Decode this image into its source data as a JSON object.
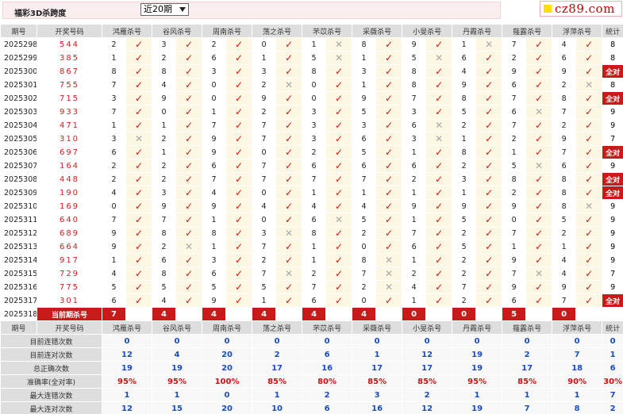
{
  "header": {
    "title": "福彩3D杀跨度",
    "select_value": "近20期",
    "logo_text": "cz89.com"
  },
  "columns": {
    "period": "期号",
    "draw": "开奖号码",
    "experts": [
      "鸿雁杀号",
      "谷风杀号",
      "周南杀号",
      "荡之杀号",
      "芣苡杀号",
      "采薇杀号",
      "小旻杀号",
      "丹霞杀号",
      "薤露杀号",
      "浮萍杀号"
    ],
    "total": "统计"
  },
  "rows": [
    {
      "p": "2025298",
      "d": "544",
      "v": [
        [
          2,
          1
        ],
        [
          3,
          1
        ],
        [
          2,
          1
        ],
        [
          0,
          1
        ],
        [
          1,
          0
        ],
        [
          8,
          1
        ],
        [
          9,
          1
        ],
        [
          1,
          0
        ],
        [
          7,
          1
        ],
        [
          4,
          1
        ]
      ],
      "c": "8"
    },
    {
      "p": "2025299",
      "d": "385",
      "v": [
        [
          1,
          1
        ],
        [
          2,
          1
        ],
        [
          6,
          1
        ],
        [
          1,
          1
        ],
        [
          5,
          0
        ],
        [
          1,
          1
        ],
        [
          5,
          0
        ],
        [
          6,
          1
        ],
        [
          2,
          1
        ],
        [
          6,
          1
        ]
      ],
      "c": "8"
    },
    {
      "p": "2025300",
      "d": "867",
      "v": [
        [
          8,
          1
        ],
        [
          8,
          1
        ],
        [
          3,
          1
        ],
        [
          3,
          1
        ],
        [
          8,
          1
        ],
        [
          3,
          1
        ],
        [
          8,
          1
        ],
        [
          4,
          1
        ],
        [
          9,
          1
        ],
        [
          9,
          1
        ]
      ],
      "c": "全对"
    },
    {
      "p": "2025301",
      "d": "755",
      "v": [
        [
          7,
          1
        ],
        [
          4,
          1
        ],
        [
          0,
          1
        ],
        [
          2,
          0
        ],
        [
          0,
          1
        ],
        [
          1,
          1
        ],
        [
          8,
          1
        ],
        [
          9,
          1
        ],
        [
          6,
          1
        ],
        [
          2,
          0
        ]
      ],
      "c": "8"
    },
    {
      "p": "2025302",
      "d": "715",
      "v": [
        [
          3,
          1
        ],
        [
          9,
          1
        ],
        [
          0,
          1
        ],
        [
          9,
          1
        ],
        [
          0,
          1
        ],
        [
          9,
          1
        ],
        [
          7,
          1
        ],
        [
          8,
          1
        ],
        [
          7,
          1
        ],
        [
          8,
          1
        ]
      ],
      "c": "全对"
    },
    {
      "p": "2025303",
      "d": "933",
      "v": [
        [
          7,
          1
        ],
        [
          0,
          1
        ],
        [
          1,
          1
        ],
        [
          2,
          1
        ],
        [
          3,
          1
        ],
        [
          5,
          1
        ],
        [
          3,
          1
        ],
        [
          5,
          1
        ],
        [
          6,
          0
        ],
        [
          7,
          1
        ]
      ],
      "c": "9"
    },
    {
      "p": "2025304",
      "d": "471",
      "v": [
        [
          1,
          1
        ],
        [
          1,
          1
        ],
        [
          7,
          1
        ],
        [
          7,
          1
        ],
        [
          3,
          1
        ],
        [
          3,
          1
        ],
        [
          6,
          0
        ],
        [
          2,
          1
        ],
        [
          7,
          1
        ],
        [
          2,
          1
        ]
      ],
      "c": "9"
    },
    {
      "p": "2025305",
      "d": "310",
      "v": [
        [
          3,
          0
        ],
        [
          2,
          1
        ],
        [
          9,
          1
        ],
        [
          7,
          1
        ],
        [
          3,
          1
        ],
        [
          6,
          1
        ],
        [
          3,
          0
        ],
        [
          1,
          1
        ],
        [
          2,
          1
        ],
        [
          9,
          1
        ]
      ],
      "c": "7"
    },
    {
      "p": "2025306",
      "d": "697",
      "v": [
        [
          6,
          1
        ],
        [
          1,
          1
        ],
        [
          9,
          1
        ],
        [
          0,
          1
        ],
        [
          2,
          1
        ],
        [
          5,
          1
        ],
        [
          1,
          1
        ],
        [
          8,
          1
        ],
        [
          1,
          1
        ],
        [
          7,
          1
        ]
      ],
      "c": "全对"
    },
    {
      "p": "2025307",
      "d": "164",
      "v": [
        [
          2,
          1
        ],
        [
          2,
          1
        ],
        [
          6,
          1
        ],
        [
          7,
          1
        ],
        [
          6,
          1
        ],
        [
          6,
          1
        ],
        [
          6,
          1
        ],
        [
          2,
          1
        ],
        [
          5,
          0
        ],
        [
          6,
          1
        ]
      ],
      "c": "9"
    },
    {
      "p": "2025308",
      "d": "448",
      "v": [
        [
          2,
          1
        ],
        [
          2,
          1
        ],
        [
          7,
          1
        ],
        [
          7,
          1
        ],
        [
          7,
          1
        ],
        [
          7,
          1
        ],
        [
          2,
          1
        ],
        [
          3,
          1
        ],
        [
          8,
          1
        ],
        [
          8,
          1
        ]
      ],
      "c": "全对"
    },
    {
      "p": "2025309",
      "d": "190",
      "v": [
        [
          4,
          1
        ],
        [
          3,
          1
        ],
        [
          4,
          1
        ],
        [
          0,
          1
        ],
        [
          1,
          1
        ],
        [
          1,
          1
        ],
        [
          1,
          1
        ],
        [
          1,
          1
        ],
        [
          2,
          1
        ],
        [
          8,
          1
        ]
      ],
      "c": "全对"
    },
    {
      "p": "2025310",
      "d": "169",
      "v": [
        [
          0,
          1
        ],
        [
          9,
          1
        ],
        [
          9,
          1
        ],
        [
          4,
          1
        ],
        [
          4,
          1
        ],
        [
          4,
          1
        ],
        [
          9,
          1
        ],
        [
          9,
          1
        ],
        [
          9,
          1
        ],
        [
          8,
          0
        ]
      ],
      "c": "9"
    },
    {
      "p": "2025311",
      "d": "640",
      "v": [
        [
          7,
          1
        ],
        [
          7,
          1
        ],
        [
          1,
          1
        ],
        [
          0,
          1
        ],
        [
          6,
          0
        ],
        [
          5,
          1
        ],
        [
          1,
          1
        ],
        [
          5,
          1
        ],
        [
          0,
          1
        ],
        [
          5,
          1
        ]
      ],
      "c": "9"
    },
    {
      "p": "2025312",
      "d": "689",
      "v": [
        [
          9,
          1
        ],
        [
          8,
          1
        ],
        [
          8,
          1
        ],
        [
          3,
          0
        ],
        [
          8,
          1
        ],
        [
          2,
          1
        ],
        [
          7,
          1
        ],
        [
          2,
          1
        ],
        [
          7,
          1
        ],
        [
          2,
          1
        ]
      ],
      "c": "9"
    },
    {
      "p": "2025313",
      "d": "664",
      "v": [
        [
          9,
          1
        ],
        [
          2,
          0
        ],
        [
          1,
          1
        ],
        [
          7,
          1
        ],
        [
          1,
          1
        ],
        [
          0,
          1
        ],
        [
          6,
          1
        ],
        [
          5,
          1
        ],
        [
          1,
          1
        ],
        [
          1,
          1
        ]
      ],
      "c": "9"
    },
    {
      "p": "2025314",
      "d": "917",
      "v": [
        [
          1,
          1
        ],
        [
          6,
          1
        ],
        [
          3,
          1
        ],
        [
          2,
          1
        ],
        [
          1,
          1
        ],
        [
          8,
          0
        ],
        [
          1,
          1
        ],
        [
          2,
          1
        ],
        [
          9,
          1
        ],
        [
          4,
          1
        ]
      ],
      "c": "9"
    },
    {
      "p": "2025315",
      "d": "729",
      "v": [
        [
          4,
          1
        ],
        [
          8,
          1
        ],
        [
          6,
          1
        ],
        [
          7,
          0
        ],
        [
          2,
          1
        ],
        [
          7,
          0
        ],
        [
          2,
          1
        ],
        [
          2,
          1
        ],
        [
          7,
          0
        ],
        [
          4,
          1
        ]
      ],
      "c": "7"
    },
    {
      "p": "2025316",
      "d": "775",
      "v": [
        [
          5,
          1
        ],
        [
          5,
          1
        ],
        [
          5,
          1
        ],
        [
          5,
          1
        ],
        [
          7,
          1
        ],
        [
          2,
          0
        ],
        [
          4,
          1
        ],
        [
          7,
          1
        ],
        [
          9,
          1
        ],
        [
          9,
          1
        ]
      ],
      "c": "9"
    },
    {
      "p": "2025317",
      "d": "301",
      "v": [
        [
          6,
          1
        ],
        [
          4,
          1
        ],
        [
          9,
          1
        ],
        [
          1,
          1
        ],
        [
          6,
          1
        ],
        [
          0,
          1
        ],
        [
          1,
          1
        ],
        [
          2,
          1
        ],
        [
          6,
          1
        ],
        [
          7,
          1
        ]
      ],
      "c": "全对"
    }
  ],
  "current": {
    "p": "2025318",
    "label": "当前期杀号",
    "v": [
      "7",
      "4",
      "4",
      "4",
      "4",
      "4",
      "0",
      "0",
      "5",
      "0"
    ]
  },
  "stats": [
    {
      "label": "目前连错次数",
      "v": [
        "0",
        "0",
        "0",
        "0",
        "0",
        "0",
        "0",
        "0",
        "0",
        "0"
      ],
      "t": "0"
    },
    {
      "label": "目前连对次数",
      "v": [
        "12",
        "4",
        "20",
        "2",
        "6",
        "1",
        "12",
        "19",
        "2",
        "7"
      ],
      "t": "1"
    },
    {
      "label": "总正确次数",
      "v": [
        "19",
        "19",
        "20",
        "17",
        "16",
        "17",
        "17",
        "19",
        "17",
        "18"
      ],
      "t": "6"
    },
    {
      "label": "准确率(全对率)",
      "v": [
        "95%",
        "95%",
        "100%",
        "85%",
        "80%",
        "85%",
        "85%",
        "95%",
        "85%",
        "90%"
      ],
      "t": "30%",
      "rate": true
    },
    {
      "label": "最大连错次数",
      "v": [
        "1",
        "1",
        "0",
        "1",
        "2",
        "3",
        "2",
        "1",
        "1",
        "1"
      ],
      "t": "7"
    },
    {
      "label": "最大连对次数",
      "v": [
        "12",
        "15",
        "20",
        "10",
        "6",
        "16",
        "12",
        "19",
        "7",
        "8"
      ],
      "t": "2"
    }
  ],
  "colors": {
    "accent": "#c91a1a",
    "check": "#e01010",
    "cross": "#a8a8a8",
    "stat_blue": "#1a4dbf"
  },
  "icons": {
    "correct": "check-icon",
    "wrong": "cross-icon",
    "dropdown": "chevron-down-icon"
  }
}
